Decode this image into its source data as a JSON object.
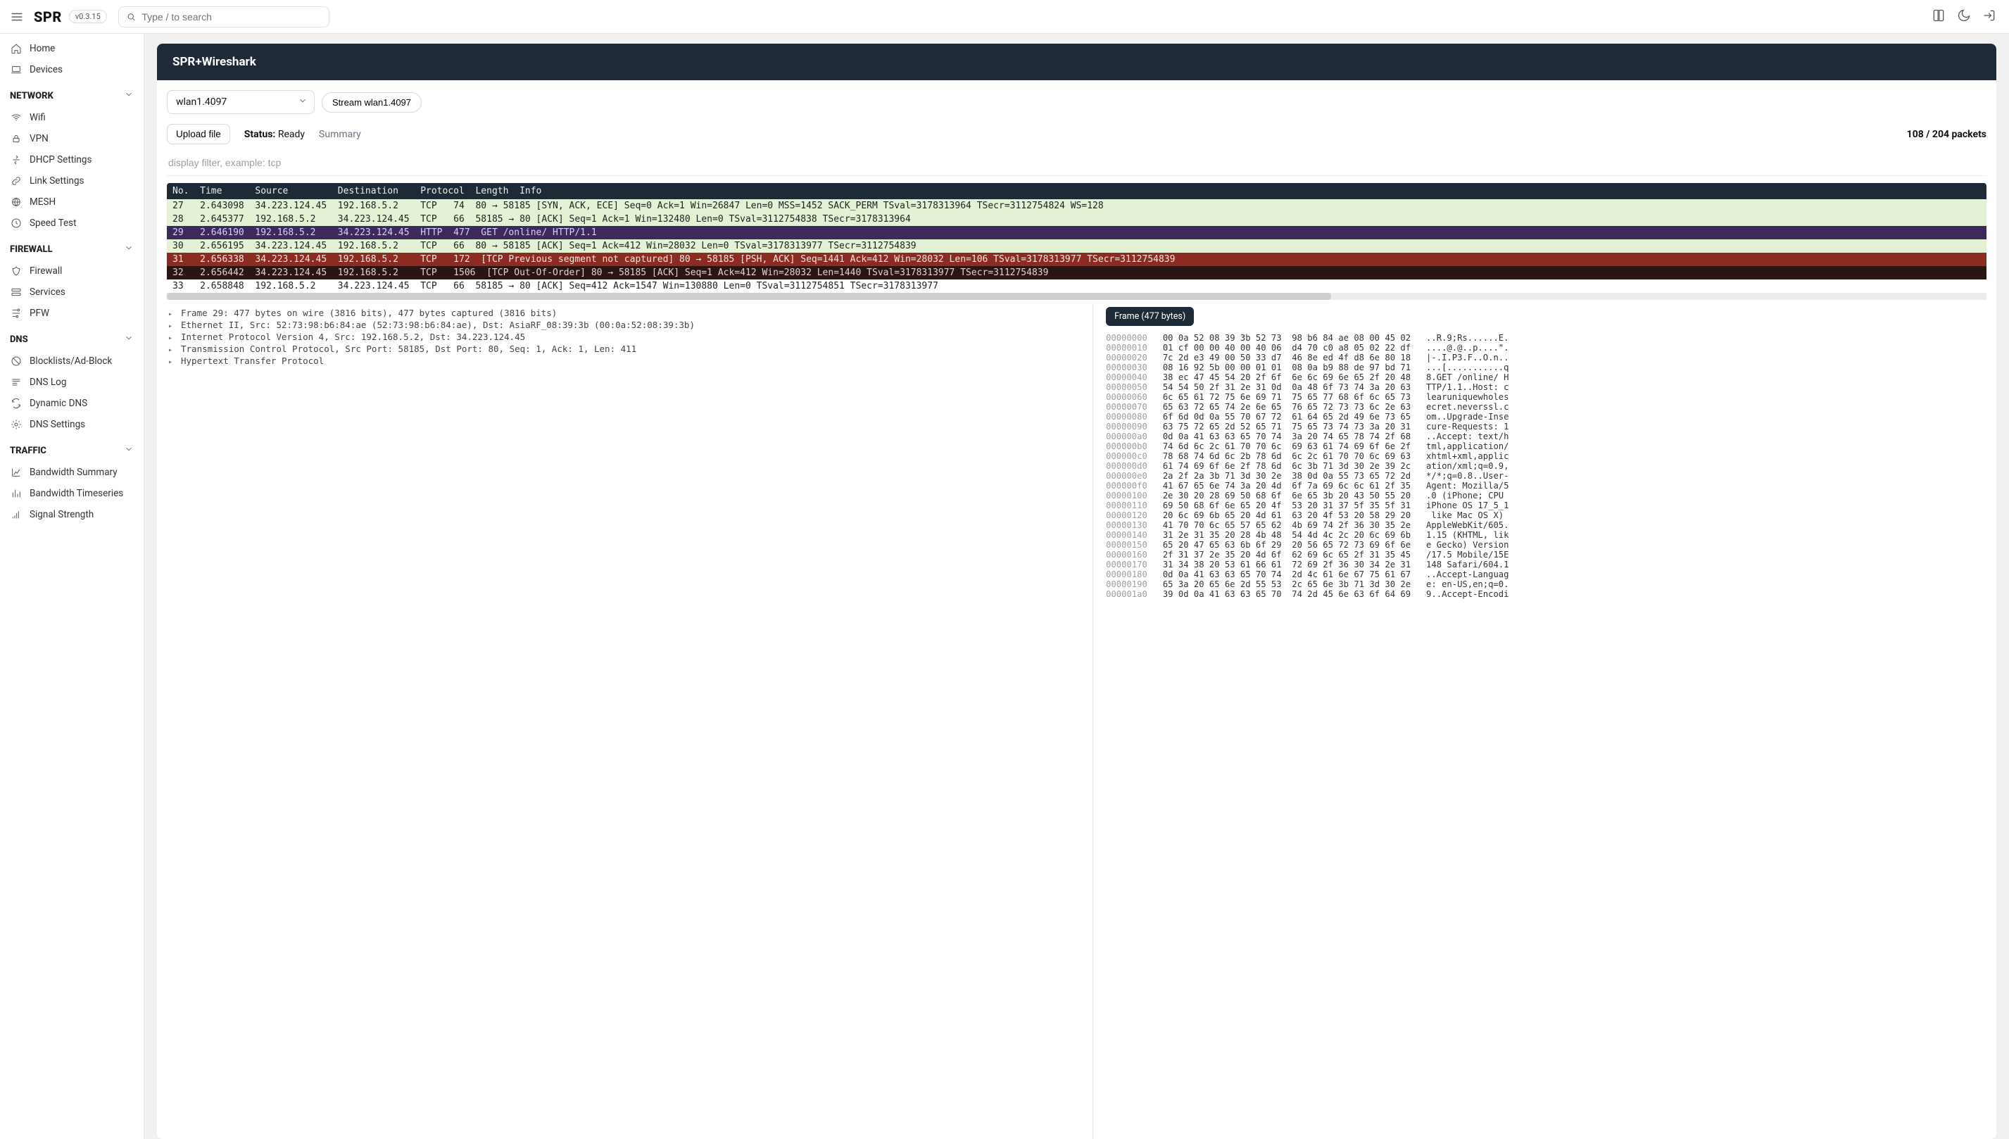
{
  "topbar": {
    "app": "SPR",
    "version": "v0.3.15",
    "search_placeholder": "Type / to search"
  },
  "sidebar": {
    "home": "Home",
    "devices": "Devices",
    "sections": {
      "network": "NETWORK",
      "firewall": "FIREWALL",
      "dns": "DNS",
      "traffic": "TRAFFIC"
    },
    "network_items": [
      "Wifi",
      "VPN",
      "DHCP Settings",
      "Link Settings",
      "MESH",
      "Speed Test"
    ],
    "firewall_items": [
      "Firewall",
      "Services",
      "PFW"
    ],
    "dns_items": [
      "Blocklists/Ad-Block",
      "DNS Log",
      "Dynamic DNS",
      "DNS Settings"
    ],
    "traffic_items": [
      "Bandwidth Summary",
      "Bandwidth Timeseries",
      "Signal Strength"
    ]
  },
  "header": {
    "title": "SPR+Wireshark"
  },
  "controls": {
    "iface_select": "wlan1.4097",
    "stream_btn": "Stream wlan1.4097",
    "upload": "Upload file",
    "status_label": "Status:",
    "status_value": "Ready",
    "summary": "Summary",
    "packets_count": "108 / 204 packets",
    "filter_placeholder": "display filter, example: tcp"
  },
  "table": {
    "header": "No.  Time      Source         Destination    Protocol  Length  Info",
    "rows": [
      {
        "cls": "bg-green",
        "t": "27   2.643098  34.223.124.45  192.168.5.2    TCP   74  80 → 58185 [SYN, ACK, ECE] Seq=0 Ack=1 Win=26847 Len=0 MSS=1452 SACK_PERM TSval=3178313964 TSecr=3112754824 WS=128"
      },
      {
        "cls": "bg-green",
        "t": "28   2.645377  192.168.5.2    34.223.124.45  TCP   66  58185 → 80 [ACK] Seq=1 Ack=1 Win=132480 Len=0 TSval=3112754838 TSecr=3178313964"
      },
      {
        "cls": "bg-purple",
        "t": "29   2.646190  192.168.5.2    34.223.124.45  HTTP  477  GET /online/ HTTP/1.1"
      },
      {
        "cls": "bg-green",
        "t": "30   2.656195  34.223.124.45  192.168.5.2    TCP   66  80 → 58185 [ACK] Seq=1 Ack=412 Win=28032 Len=0 TSval=3178313977 TSecr=3112754839"
      },
      {
        "cls": "bg-red",
        "t": "31   2.656338  34.223.124.45  192.168.5.2    TCP   172  [TCP Previous segment not captured] 80 → 58185 [PSH, ACK] Seq=1441 Ack=412 Win=28032 Len=106 TSval=3178313977 TSecr=3112754839"
      },
      {
        "cls": "bg-darkred",
        "t": "32   2.656442  34.223.124.45  192.168.5.2    TCP   1506  [TCP Out-Of-Order] 80 → 58185 [ACK] Seq=1 Ack=412 Win=28032 Len=1440 TSval=3178313977 TSecr=3112754839"
      },
      {
        "cls": "bg-plain",
        "t": "33   2.658848  192.168.5.2    34.223.124.45  TCP   66  58185 → 80 [ACK] Seq=412 Ack=1547 Win=130880 Len=0 TSval=3112754851 TSecr=3178313977"
      }
    ]
  },
  "tree": [
    "Frame 29: 477 bytes on wire (3816 bits), 477 bytes captured (3816 bits)",
    "Ethernet II, Src: 52:73:98:b6:84:ae (52:73:98:b6:84:ae), Dst: AsiaRF_08:39:3b (00:0a:52:08:39:3b)",
    "Internet Protocol Version 4, Src: 192.168.5.2, Dst: 34.223.124.45",
    "Transmission Control Protocol, Src Port: 58185, Dst Port: 80, Seq: 1, Ack: 1, Len: 411",
    "Hypertext Transfer Protocol"
  ],
  "hex": {
    "frame_label": "Frame (477 bytes)",
    "lines": [
      {
        "off": "00000000",
        "h": "00 0a 52 08 39 3b 52 73  98 b6 84 ae 08 00 45 02",
        "a": "..R.9;Rs......E."
      },
      {
        "off": "00000010",
        "h": "01 cf 00 00 40 00 40 06  d4 70 c0 a8 05 02 22 df",
        "a": "....@.@..p....\"."
      },
      {
        "off": "00000020",
        "h": "7c 2d e3 49 00 50 33 d7  46 8e ed 4f d8 6e 80 18",
        "a": "|-.I.P3.F..O.n.."
      },
      {
        "off": "00000030",
        "h": "08 16 92 5b 00 00 01 01  08 0a b9 88 de 97 bd 71",
        "a": "...[...........q"
      },
      {
        "off": "00000040",
        "h": "38 ec 47 45 54 20 2f 6f  6e 6c 69 6e 65 2f 20 48",
        "a": "8.GET /online/ H"
      },
      {
        "off": "00000050",
        "h": "54 54 50 2f 31 2e 31 0d  0a 48 6f 73 74 3a 20 63",
        "a": "TTP/1.1..Host: c"
      },
      {
        "off": "00000060",
        "h": "6c 65 61 72 75 6e 69 71  75 65 77 68 6f 6c 65 73",
        "a": "learuniquewholes"
      },
      {
        "off": "00000070",
        "h": "65 63 72 65 74 2e 6e 65  76 65 72 73 73 6c 2e 63",
        "a": "ecret.neverssl.c"
      },
      {
        "off": "00000080",
        "h": "6f 6d 0d 0a 55 70 67 72  61 64 65 2d 49 6e 73 65",
        "a": "om..Upgrade-Inse"
      },
      {
        "off": "00000090",
        "h": "63 75 72 65 2d 52 65 71  75 65 73 74 73 3a 20 31",
        "a": "cure-Requests: 1"
      },
      {
        "off": "000000a0",
        "h": "0d 0a 41 63 63 65 70 74  3a 20 74 65 78 74 2f 68",
        "a": "..Accept: text/h"
      },
      {
        "off": "000000b0",
        "h": "74 6d 6c 2c 61 70 70 6c  69 63 61 74 69 6f 6e 2f",
        "a": "tml,application/"
      },
      {
        "off": "000000c0",
        "h": "78 68 74 6d 6c 2b 78 6d  6c 2c 61 70 70 6c 69 63",
        "a": "xhtml+xml,applic"
      },
      {
        "off": "000000d0",
        "h": "61 74 69 6f 6e 2f 78 6d  6c 3b 71 3d 30 2e 39 2c",
        "a": "ation/xml;q=0.9,"
      },
      {
        "off": "000000e0",
        "h": "2a 2f 2a 3b 71 3d 30 2e  38 0d 0a 55 73 65 72 2d",
        "a": "*/*;q=0.8..User-"
      },
      {
        "off": "000000f0",
        "h": "41 67 65 6e 74 3a 20 4d  6f 7a 69 6c 6c 61 2f 35",
        "a": "Agent: Mozilla/5"
      },
      {
        "off": "00000100",
        "h": "2e 30 20 28 69 50 68 6f  6e 65 3b 20 43 50 55 20",
        "a": ".0 (iPhone; CPU "
      },
      {
        "off": "00000110",
        "h": "69 50 68 6f 6e 65 20 4f  53 20 31 37 5f 35 5f 31",
        "a": "iPhone OS 17_5_1"
      },
      {
        "off": "00000120",
        "h": "20 6c 69 6b 65 20 4d 61  63 20 4f 53 20 58 29 20",
        "a": " like Mac OS X) "
      },
      {
        "off": "00000130",
        "h": "41 70 70 6c 65 57 65 62  4b 69 74 2f 36 30 35 2e",
        "a": "AppleWebKit/605."
      },
      {
        "off": "00000140",
        "h": "31 2e 31 35 20 28 4b 48  54 4d 4c 2c 20 6c 69 6b",
        "a": "1.15 (KHTML, lik"
      },
      {
        "off": "00000150",
        "h": "65 20 47 65 63 6b 6f 29  20 56 65 72 73 69 6f 6e",
        "a": "e Gecko) Version"
      },
      {
        "off": "00000160",
        "h": "2f 31 37 2e 35 20 4d 6f  62 69 6c 65 2f 31 35 45",
        "a": "/17.5 Mobile/15E"
      },
      {
        "off": "00000170",
        "h": "31 34 38 20 53 61 66 61  72 69 2f 36 30 34 2e 31",
        "a": "148 Safari/604.1"
      },
      {
        "off": "00000180",
        "h": "0d 0a 41 63 63 65 70 74  2d 4c 61 6e 67 75 61 67",
        "a": "..Accept-Languag"
      },
      {
        "off": "00000190",
        "h": "65 3a 20 65 6e 2d 55 53  2c 65 6e 3b 71 3d 30 2e",
        "a": "e: en-US,en;q=0."
      },
      {
        "off": "000001a0",
        "h": "39 0d 0a 41 63 63 65 70  74 2d 45 6e 63 6f 64 69",
        "a": "9..Accept-Encodi"
      }
    ]
  }
}
